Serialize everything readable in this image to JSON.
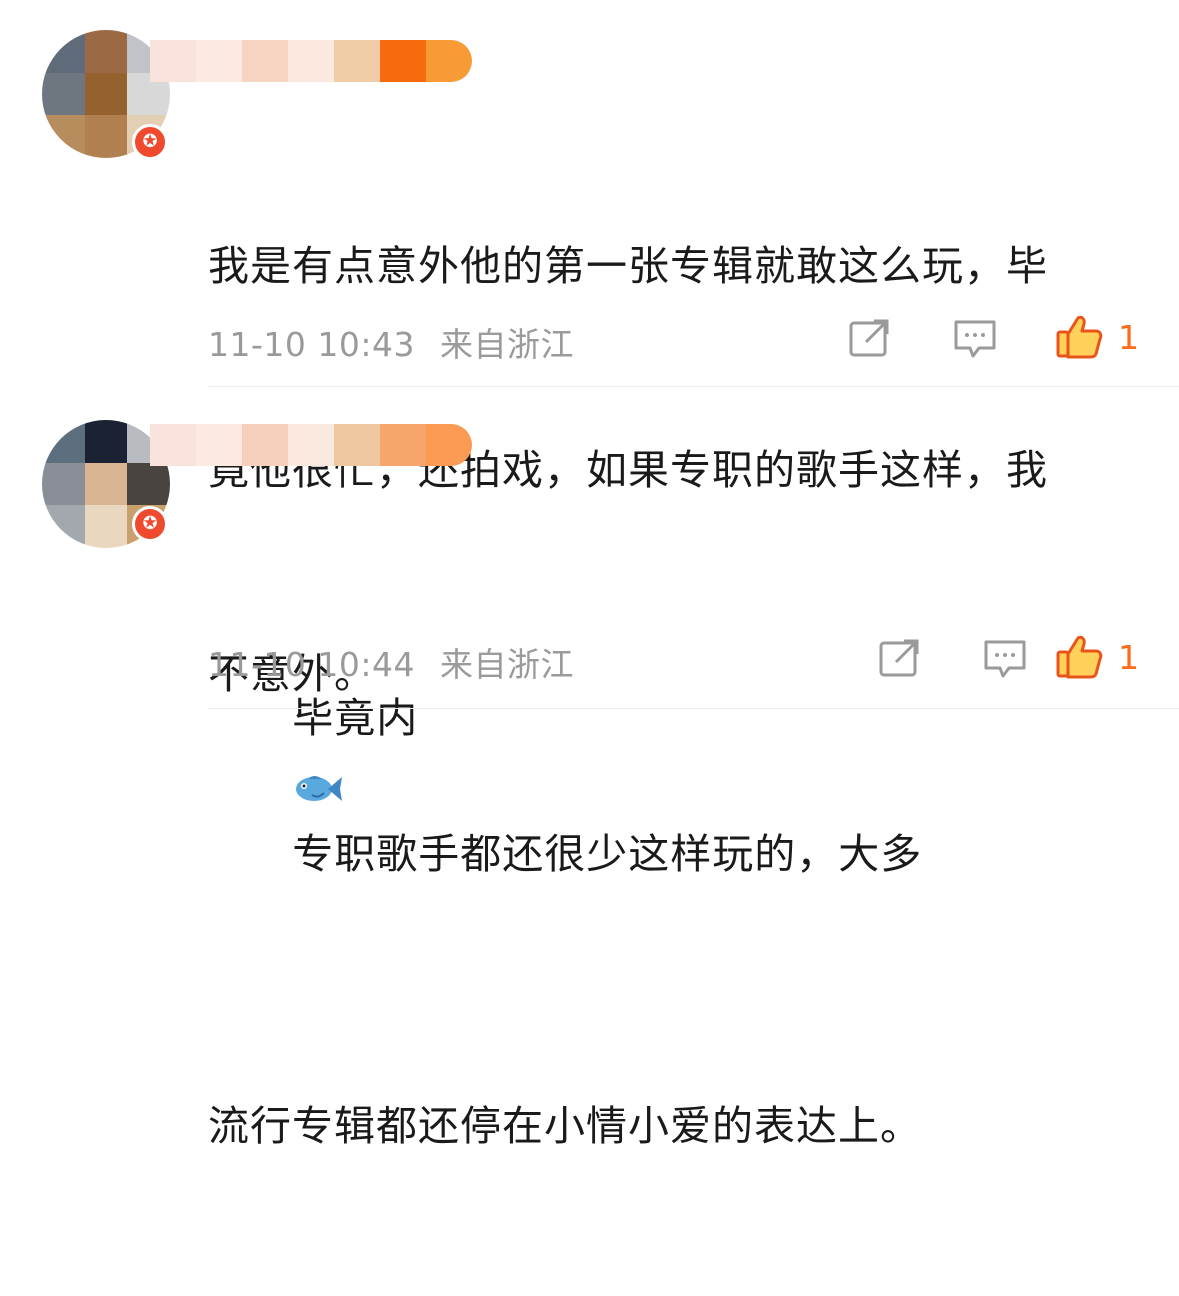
{
  "comments": [
    {
      "text_lines": [
        "我是有点意外他的第一张专辑就敢这么玩，毕",
        "竟他很忙，还拍戏，如果专职的歌手这样，我",
        "不意外。"
      ],
      "time": "11-10 10:43",
      "location": "来自浙江",
      "like_count": "1",
      "icons": {
        "share": "share-icon",
        "comment": "comment-icon",
        "like": "thumbs-up-icon",
        "badge": "verified-badge-icon"
      }
    },
    {
      "text_line1_before": "毕竟内",
      "text_emoji": "fish-emoji",
      "text_line1_after": "专职歌手都还很少这样玩的，大多",
      "text_line2": "流行专辑都还停在小情小爱的表达上。",
      "time": "11-10 10:44",
      "location": "来自浙江",
      "like_count": "1",
      "icons": {
        "share": "share-icon",
        "comment": "comment-icon",
        "like": "thumbs-up-icon",
        "badge": "verified-badge-icon"
      }
    }
  ],
  "colors": {
    "accent": "#ff6a1a",
    "meta": "#9a9a9a",
    "text": "#1a1a1a",
    "badge": "#f04a2e"
  }
}
